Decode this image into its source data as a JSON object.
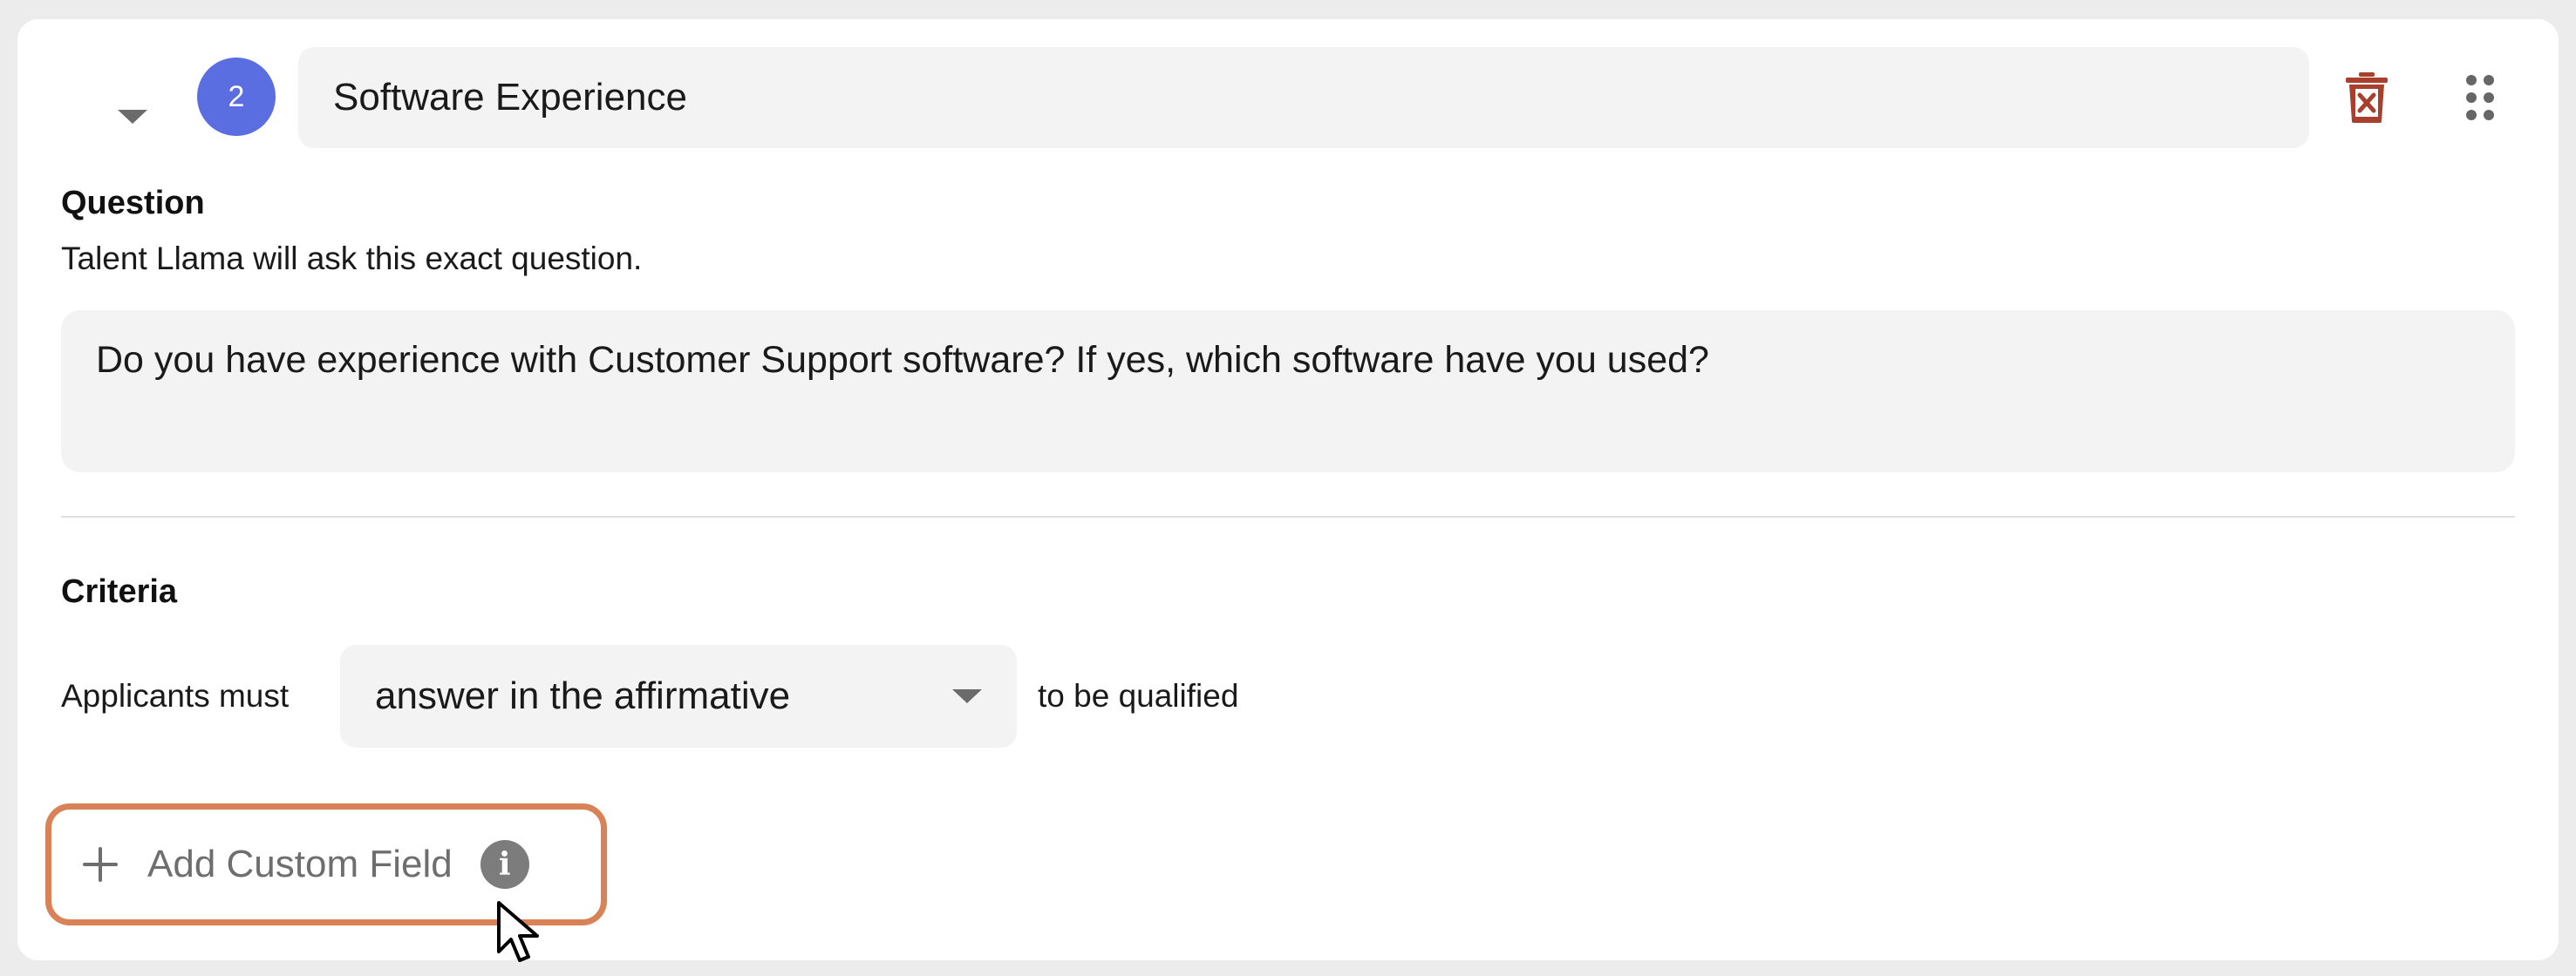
{
  "question_card": {
    "step_number": "2",
    "title_value": "Software Experience",
    "question_heading": "Question",
    "question_helper": "Talent Llama will ask this exact question.",
    "question_text": "Do you have experience with Customer Support software? If yes, which software have you used?",
    "criteria_heading": "Criteria",
    "criteria_prefix": "Applicants must",
    "criteria_selected": "answer in the affirmative",
    "criteria_suffix": "to be qualified",
    "add_field_label": "Add Custom Field",
    "add_field_plus": "+",
    "info_glyph": "i"
  },
  "icons": {
    "collapse": "chevron-down-icon",
    "delete": "trash-x-icon",
    "drag": "drag-handle-icon",
    "info": "info-icon",
    "plus": "plus-icon",
    "cursor": "mouse-pointer-icon"
  },
  "colors": {
    "badge": "#5b6ee1",
    "delete": "#a8402e",
    "highlight_border": "#d98257",
    "field_background": "#f3f3f3",
    "muted_text": "#6e6e6e"
  }
}
